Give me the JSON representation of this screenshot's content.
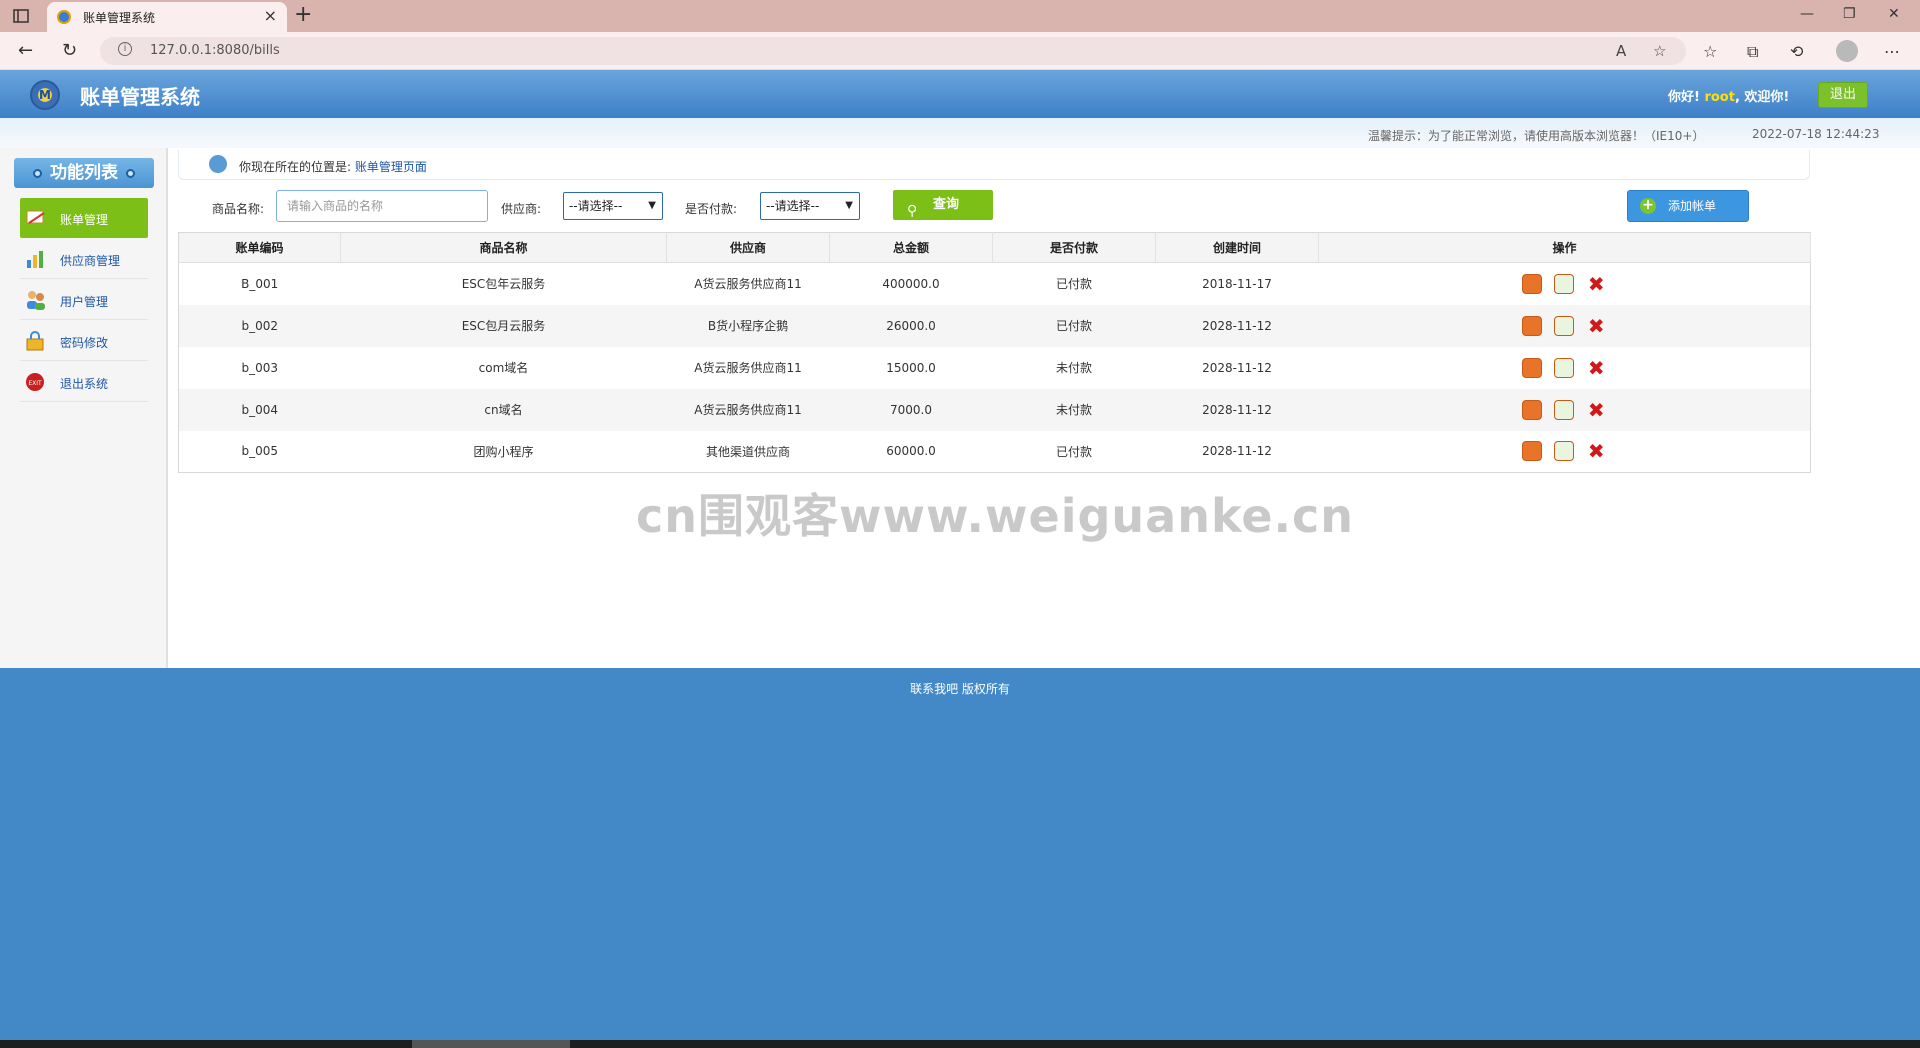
{
  "browser": {
    "tab_title": "账单管理系统",
    "url": "127.0.0.1:8080/bills"
  },
  "header": {
    "title": "账单管理系统",
    "greeting_prefix": "你好!",
    "username": "root",
    "greeting_suffix": ", 欢迎你!",
    "logout_label": "退出"
  },
  "tipbar": {
    "tip": "温馨提示：为了能正常浏览，请使用高版本浏览器！（IE10+）",
    "datetime": "2022-07-18 12:44:23"
  },
  "sidebar": {
    "title": "功能列表",
    "items": [
      {
        "label": "账单管理",
        "active": true
      },
      {
        "label": "供应商管理",
        "active": false
      },
      {
        "label": "用户管理",
        "active": false
      },
      {
        "label": "密码修改",
        "active": false
      },
      {
        "label": "退出系统",
        "active": false
      }
    ]
  },
  "breadcrumb": {
    "prefix": "你现在所在的位置是:",
    "current": "账单管理页面"
  },
  "search": {
    "product_label": "商品名称:",
    "product_placeholder": "请输入商品的名称",
    "provider_label": "供应商:",
    "provider_selected": "--请选择--",
    "paid_label": "是否付款:",
    "paid_selected": "--请选择--",
    "query_label": "查询",
    "add_label": "添加帐单"
  },
  "table": {
    "headers": [
      "账单编码",
      "商品名称",
      "供应商",
      "总金额",
      "是否付款",
      "创建时间",
      "操作"
    ],
    "rows": [
      [
        "B_001",
        "ESC包年云服务",
        "A货云服务供应商11",
        "400000.0",
        "已付款",
        "2018-11-17"
      ],
      [
        "b_002",
        "ESC包月云服务",
        "B货小程序企鹅",
        "26000.0",
        "已付款",
        "2028-11-12"
      ],
      [
        "b_003",
        "com域名",
        "A货云服务供应商11",
        "15000.0",
        "未付款",
        "2028-11-12"
      ],
      [
        "b_004",
        "cn域名",
        "A货云服务供应商11",
        "7000.0",
        "未付款",
        "2028-11-12"
      ],
      [
        "b_005",
        "团购小程序",
        "其他渠道供应商",
        "60000.0",
        "已付款",
        "2028-11-12"
      ]
    ]
  },
  "watermark": "cn围观客www.weiguanke.cn",
  "footer": {
    "text": "联系我吧 版权所有"
  },
  "colors": {
    "header_blue": "#3d80c8",
    "accent_green": "#7cbf16",
    "footer_blue": "#4389c8",
    "delete_red": "#d21919"
  }
}
